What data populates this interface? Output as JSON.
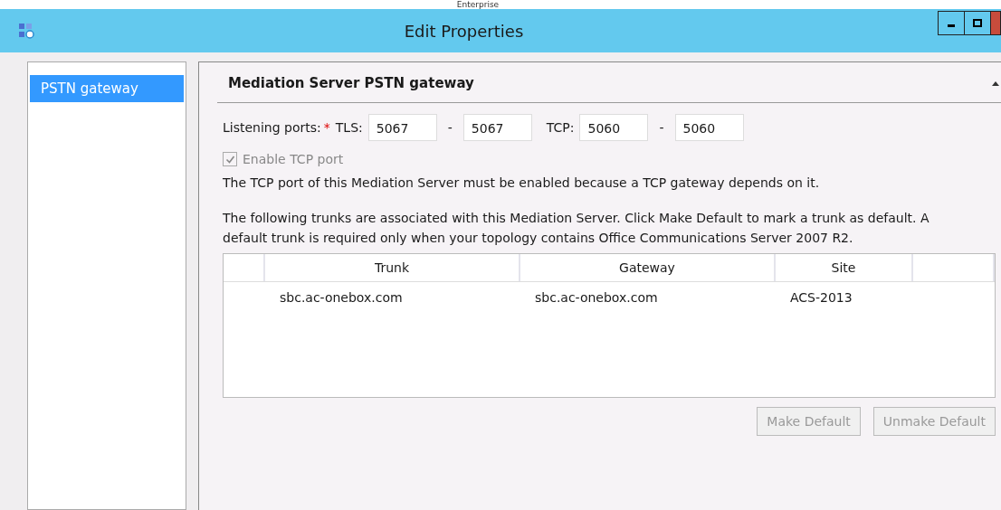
{
  "background_title": "Enterprise",
  "window": {
    "title": "Edit Properties"
  },
  "sidebar": {
    "items": [
      {
        "label": "PSTN gateway",
        "selected": true
      }
    ]
  },
  "section": {
    "title": "Mediation Server PSTN gateway",
    "expanded": true
  },
  "ports": {
    "label": "Listening ports:",
    "required_mark": "*",
    "tls_label": "TLS:",
    "tls_from": "5067",
    "separator_1": "-",
    "tls_to": "5067",
    "tcp_label": "TCP:",
    "tcp_from": "5060",
    "separator_2": "-",
    "tcp_to": "5060"
  },
  "enable_tcp": {
    "label": "Enable TCP port",
    "checked": true,
    "disabled": true
  },
  "tcp_note": "The TCP port of this Mediation Server must be enabled because a TCP gateway depends on it.",
  "trunks_note": "The following trunks are associated with this Mediation Server. Click Make Default to mark a trunk as default. A default trunk is required only when your topology contains Office Communications Server 2007 R2.",
  "table": {
    "columns": [
      "",
      "Trunk",
      "Gateway",
      "Site",
      ""
    ],
    "rows": [
      [
        "",
        "sbc.ac-onebox.com",
        "sbc.ac-onebox.com",
        "ACS-2013",
        ""
      ]
    ]
  },
  "buttons": [
    {
      "label": "Make Default",
      "disabled": true
    },
    {
      "label": "Unmake Default",
      "disabled": true
    }
  ]
}
